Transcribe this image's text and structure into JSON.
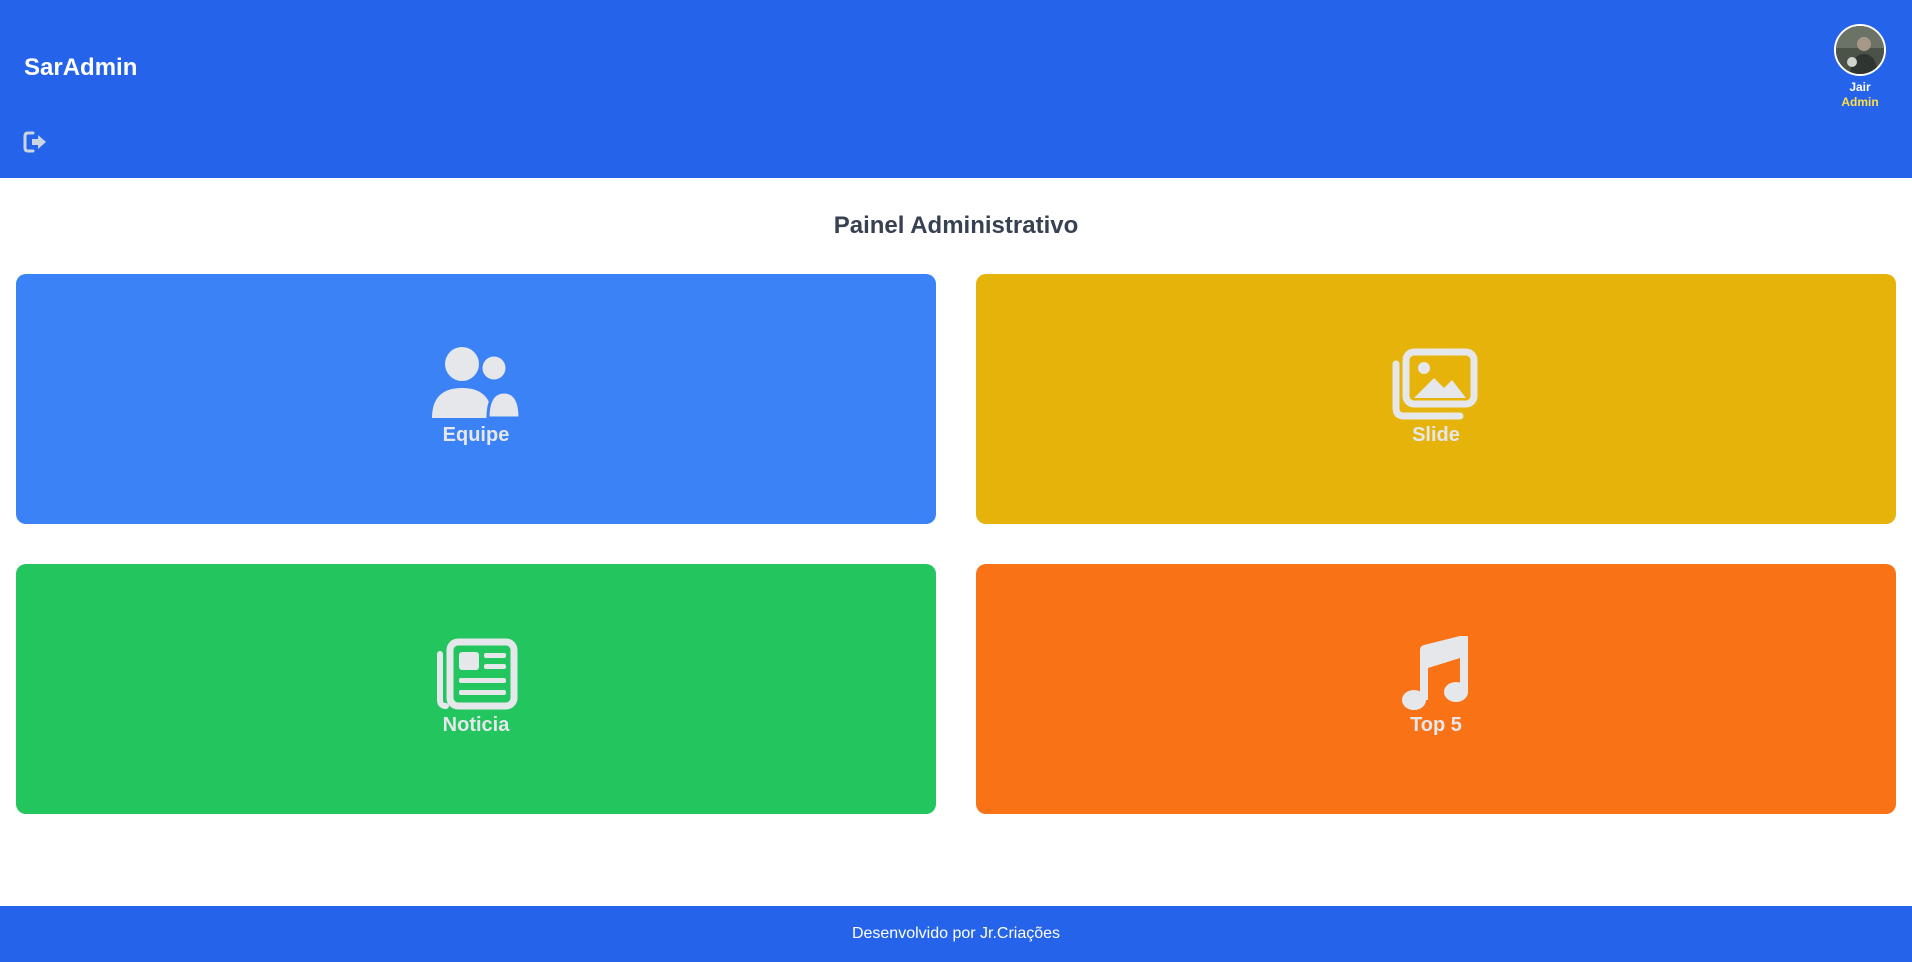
{
  "header": {
    "brand": "SarAdmin",
    "logout_icon": "sign-out-icon",
    "user": {
      "name": "Jair",
      "role": "Admin",
      "avatar_icon": "user-avatar"
    }
  },
  "main": {
    "title": "Painel Administrativo",
    "cards": [
      {
        "label": "Equipe",
        "icon": "users-icon",
        "color": "#3b82f6"
      },
      {
        "label": "Slide",
        "icon": "images-icon",
        "color": "#e6b30a"
      },
      {
        "label": "Noticia",
        "icon": "newspaper-icon",
        "color": "#22c55e"
      },
      {
        "label": "Top 5",
        "icon": "music-icon",
        "color": "#f97316"
      }
    ]
  },
  "footer": {
    "text": "Desenvolvido por Jr.Criações"
  },
  "colors": {
    "header_bg": "#2563eb",
    "footer_bg": "#2563eb",
    "role_accent": "#fde047",
    "icon_color": "#e5e7eb"
  }
}
